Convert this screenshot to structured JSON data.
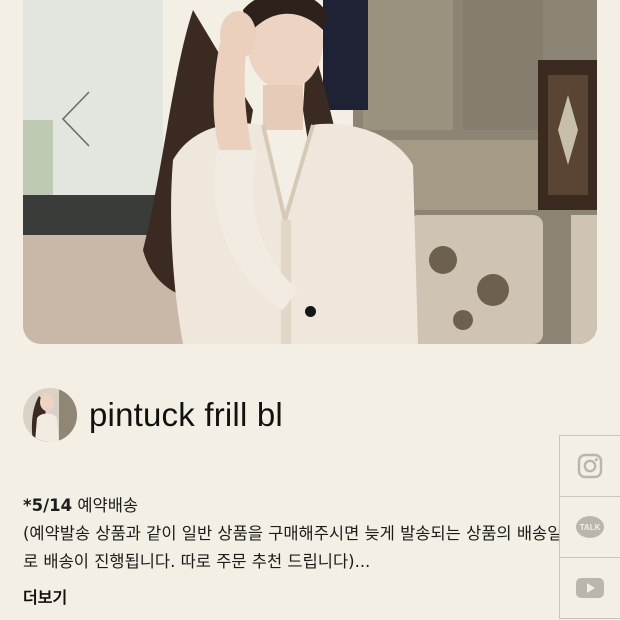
{
  "product": {
    "title": "pintuck frill bl"
  },
  "description": {
    "line1_prefix": "*5/14",
    "line1_text": " 예약배송",
    "line2": "(예약발송 상품과 같이 일반 상품을 구매해주시면 늦게 발송되는 상품의 배송일",
    "line3": "로 배송이 진행됩니다. 따로 주문 추천 드립니다)...",
    "more_label": "더보기"
  },
  "social": {
    "items": [
      {
        "icon": "instagram-icon"
      },
      {
        "icon": "kakaotalk-icon",
        "badge": "TALK"
      },
      {
        "icon": "youtube-icon"
      }
    ]
  },
  "carousel": {
    "dot_count": 1,
    "active_index": 0
  },
  "colors": {
    "background": "#f3efe4",
    "text": "#1b1b1b",
    "divider": "#c9c5bb",
    "icon": "#b9b6ae"
  }
}
